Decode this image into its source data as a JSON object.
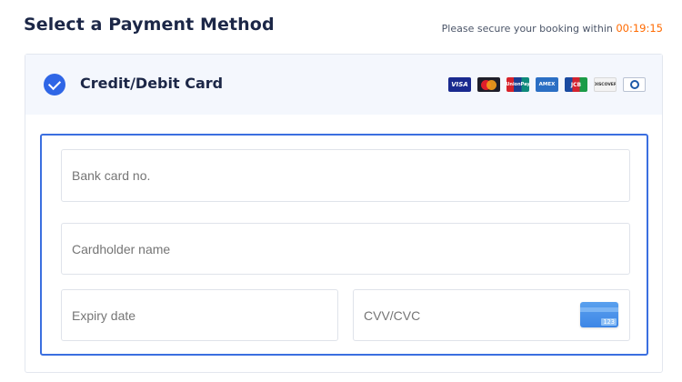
{
  "header": {
    "title": "Select a Payment Method",
    "secure_text": "Please secure your booking within",
    "countdown": "00:19:15",
    "countdown_color": "#ff6a00"
  },
  "payment_method": {
    "label": "Credit/Debit Card",
    "selected": true,
    "accent_color": "#2f66e6",
    "brands": [
      {
        "name": "visa-icon",
        "text": "VISA"
      },
      {
        "name": "mastercard-icon",
        "text": ""
      },
      {
        "name": "unionpay-icon",
        "text": "UnionPay"
      },
      {
        "name": "amex-icon",
        "text": "AMEX"
      },
      {
        "name": "jcb-icon",
        "text": "JCB"
      },
      {
        "name": "discover-icon",
        "text": "DISCOVER"
      },
      {
        "name": "diners-club-icon",
        "text": ""
      }
    ]
  },
  "form": {
    "card_number": {
      "placeholder": "Bank card no.",
      "value": ""
    },
    "cardholder": {
      "placeholder": "Cardholder name",
      "value": ""
    },
    "expiry": {
      "placeholder": "Expiry date",
      "value": ""
    },
    "cvv": {
      "placeholder": "CVV/CVC",
      "value": "",
      "hint_icon": "card-back-cvv-icon",
      "hint_text": "123"
    }
  }
}
